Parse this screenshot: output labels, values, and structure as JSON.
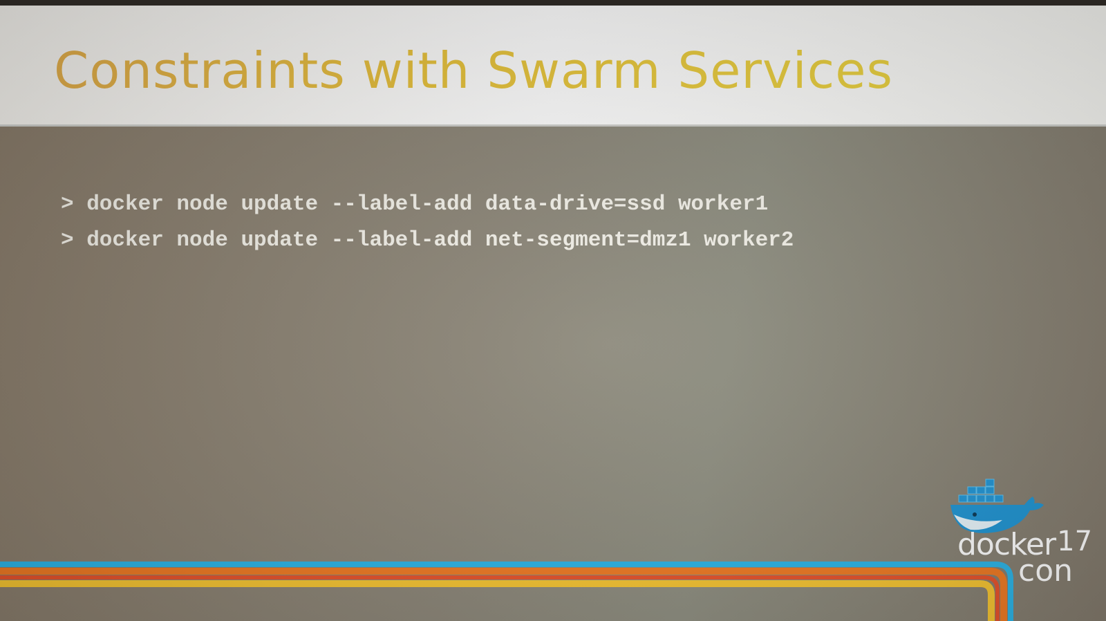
{
  "slide": {
    "title": "Constraints with Swarm Services",
    "commands": [
      "> docker node update --label-add data-drive=ssd worker1",
      "> docker node update --label-add net-segment=dmz1 worker2"
    ]
  },
  "logo": {
    "brand": "docker",
    "year": "17",
    "suffix": "con",
    "icon": "docker-whale-icon"
  },
  "colors": {
    "title_gradient_start": "#e3ae4a",
    "title_gradient_end": "#ebd23f",
    "stripe_blue": "#2bb5e8",
    "stripe_orange": "#f07a22",
    "stripe_yellow": "#f7c531"
  }
}
